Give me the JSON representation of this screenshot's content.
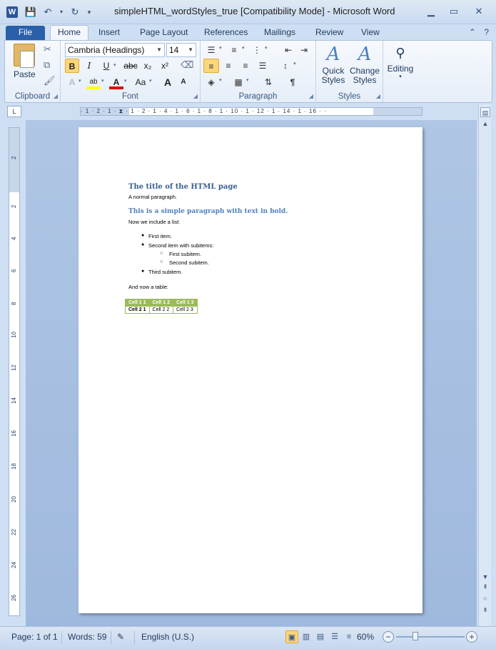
{
  "window": {
    "app_icon": "W",
    "title": "simpleHTML_wordStyles_true [Compatibility Mode]  -  Microsoft Word"
  },
  "tabs": [
    "File",
    "Home",
    "Insert",
    "Page Layout",
    "References",
    "Mailings",
    "Review",
    "View"
  ],
  "ribbon": {
    "clipboard": {
      "label": "Clipboard",
      "paste": "Paste"
    },
    "font": {
      "label": "Font",
      "family": "Cambria (Headings)",
      "size": "14",
      "bold": "B",
      "italic": "I",
      "underline": "U",
      "strike": "abc",
      "subscript": "x₂",
      "superscript": "x²",
      "grow": "A",
      "shrink": "A",
      "change_case": "Aa"
    },
    "paragraph": {
      "label": "Paragraph"
    },
    "styles": {
      "label": "Styles",
      "quick": "Quick Styles",
      "change": "Change Styles"
    },
    "editing": {
      "label": "Editing"
    }
  },
  "hruler_text": "· 1 · 2 · 1 · ⧗ · 1 · 2 · 1 · 4 · 1 · 6 · 1 · 8 · 1 · 10 · 1 · 12 · 1 · 14 · 1 · 16 · ·",
  "vruler_ticks": [
    "2",
    "2",
    "4",
    "6",
    "8",
    "10",
    "12",
    "14",
    "16",
    "18",
    "20",
    "22",
    "24",
    "26"
  ],
  "document": {
    "title": "The title of the HTML page",
    "para1": "A normal paragraph.",
    "bold_para": "This is a simple paragraph  with text in bold.",
    "list_intro": "Now we include a list:",
    "list": [
      {
        "text": "First item.",
        "level": 1
      },
      {
        "text": "Second item with subitems:",
        "level": 1
      },
      {
        "text": "First subitem.",
        "level": 2
      },
      {
        "text": "Second subitem.",
        "level": 2
      },
      {
        "text": "Third subitem.",
        "level": 1
      }
    ],
    "table_intro": "And now a table:",
    "table": [
      [
        "Cell 1 1",
        "Cell 1 2",
        "Cell 1 3"
      ],
      [
        "Cell 2 1",
        "Cell 2 2",
        "Cell 2 3"
      ]
    ]
  },
  "status": {
    "page": "Page: 1 of 1",
    "words": "Words: 59",
    "language": "English (U.S.)",
    "zoom": "60%",
    "zoom_level_percent": 60
  }
}
